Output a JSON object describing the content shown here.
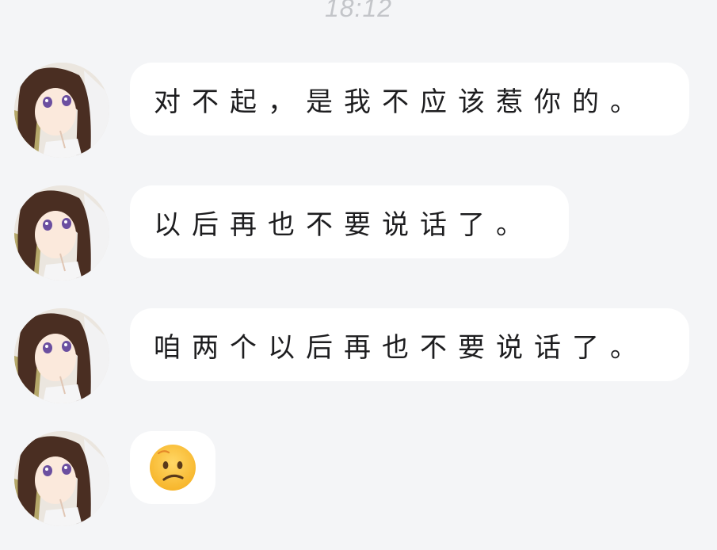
{
  "chat": {
    "timestamp": "18:12",
    "messages": [
      {
        "text": "对不起，是我不应该惹你的。"
      },
      {
        "text": "以后再也不要说话了。"
      },
      {
        "text": "咱两个以后再也不要说话了。"
      },
      {
        "emoji": "confused-face",
        "text": ""
      }
    ]
  }
}
